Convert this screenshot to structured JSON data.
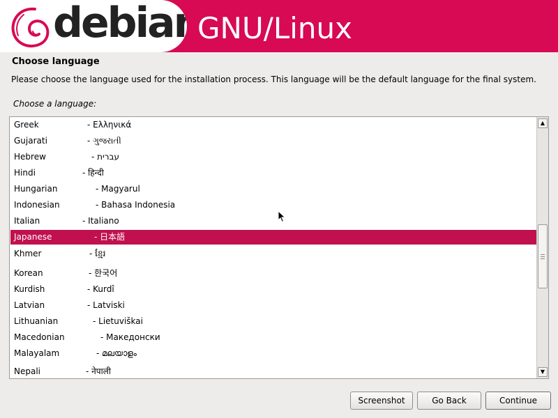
{
  "banner": {
    "brand": "debian",
    "tagline": "GNU/Linux"
  },
  "page": {
    "heading": "Choose language",
    "description": "Please choose the language used for the installation process. This language will be the default language for the final system.",
    "prompt": "Choose a language:"
  },
  "languages": [
    {
      "name": "Greek",
      "native": "- Ελληνικά"
    },
    {
      "name": "Gujarati",
      "native": "- ગુજરાતી"
    },
    {
      "name": "Hebrew",
      "native": "- עברית"
    },
    {
      "name": "Hindi",
      "native": "- हिन्दी"
    },
    {
      "name": "Hungarian",
      "native": "- Magyarul"
    },
    {
      "name": "Indonesian",
      "native": "- Bahasa Indonesia"
    },
    {
      "name": "Italian",
      "native": "- Italiano"
    },
    {
      "name": "Japanese",
      "native": "- 日本語"
    },
    {
      "name": "Khmer",
      "native": "- ខ្មែរ"
    },
    {
      "name": "Korean",
      "native": "- 한국어"
    },
    {
      "name": "Kurdish",
      "native": "- Kurdî"
    },
    {
      "name": "Latvian",
      "native": "- Latviski"
    },
    {
      "name": "Lithuanian",
      "native": "- Lietuviškai"
    },
    {
      "name": "Macedonian",
      "native": "- Македонски"
    },
    {
      "name": "Malayalam",
      "native": "- മലയാളം"
    },
    {
      "name": "Nepali",
      "native": "- नेपाली"
    }
  ],
  "selected_language": "Japanese",
  "buttons": {
    "screenshot": "Screenshot",
    "back": "Go Back",
    "continue": "Continue"
  },
  "colors": {
    "accent": "#d70a53",
    "selection": "#c0104e"
  },
  "icons": {
    "logo": "debian-swirl-icon",
    "scroll_up": "scroll-up-arrow-icon",
    "scroll_down": "scroll-down-arrow-icon",
    "pointer": "mouse-pointer-icon"
  }
}
